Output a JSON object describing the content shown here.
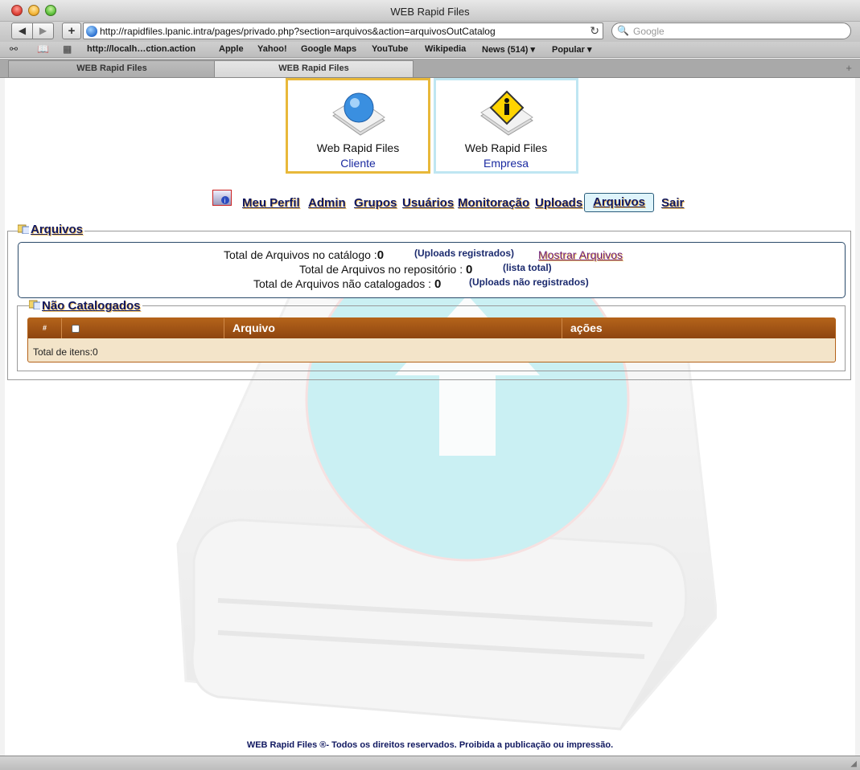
{
  "window": {
    "title": "WEB Rapid Files"
  },
  "toolbar": {
    "back_icon": "◀",
    "forward_icon": "▶",
    "add_icon": "+",
    "url": "http://rapidfiles.lpanic.intra/pages/privado.php?section=arquivos&action=arquivosOutCatalog",
    "reload_icon": "↻",
    "search_placeholder": "Google",
    "search_icon": "🔍"
  },
  "bookmarks": {
    "reader_icon": "⚯",
    "book_icon": "📖",
    "grid_icon": "▦",
    "items": [
      "http://localh…ction.action",
      "Apple",
      "Yahoo!",
      "Google Maps",
      "YouTube",
      "Wikipedia",
      "News (514) ▾",
      "Popular ▾"
    ]
  },
  "tabs": [
    {
      "label": "WEB Rapid Files"
    },
    {
      "label": "WEB Rapid Files"
    }
  ],
  "new_tab_icon": "+",
  "logos": {
    "cliente": {
      "title": "Web Rapid Files",
      "subtitle": "Cliente"
    },
    "empresa": {
      "title": "Web Rapid Files",
      "subtitle": "Empresa"
    }
  },
  "menu": {
    "items": [
      "Meu Perfil",
      "Admin",
      "Grupos",
      "Usuários",
      "Monitoração",
      "Uploads",
      "Arquivos",
      "Sair"
    ],
    "active": "Arquivos"
  },
  "arquivos": {
    "legend": "Arquivos",
    "rows": [
      {
        "label": "Total de Arquivos no catálogo :",
        "value": "0",
        "note": "(Uploads registrados)"
      },
      {
        "label": "Total de Arquivos no repositório : ",
        "value": "0",
        "note": "(lista total)"
      },
      {
        "label": "Total de Arquivos não catalogados : ",
        "value": "0",
        "note": "(Uploads não registrados)"
      }
    ],
    "mostrar_link": "Mostrar Arquivos"
  },
  "nao_catalogados": {
    "legend": "Não Catalogados",
    "columns": [
      "#",
      "",
      "Arquivo",
      "ações"
    ],
    "total_label": "Total de itens:0"
  },
  "footer": "WEB Rapid Files ®- Todos os direitos reservados. Proibida a publicação ou impressão.",
  "colors": {
    "accent_orange": "#b4631a",
    "menu_text": "#101860",
    "highlight": "#f2c46a"
  }
}
